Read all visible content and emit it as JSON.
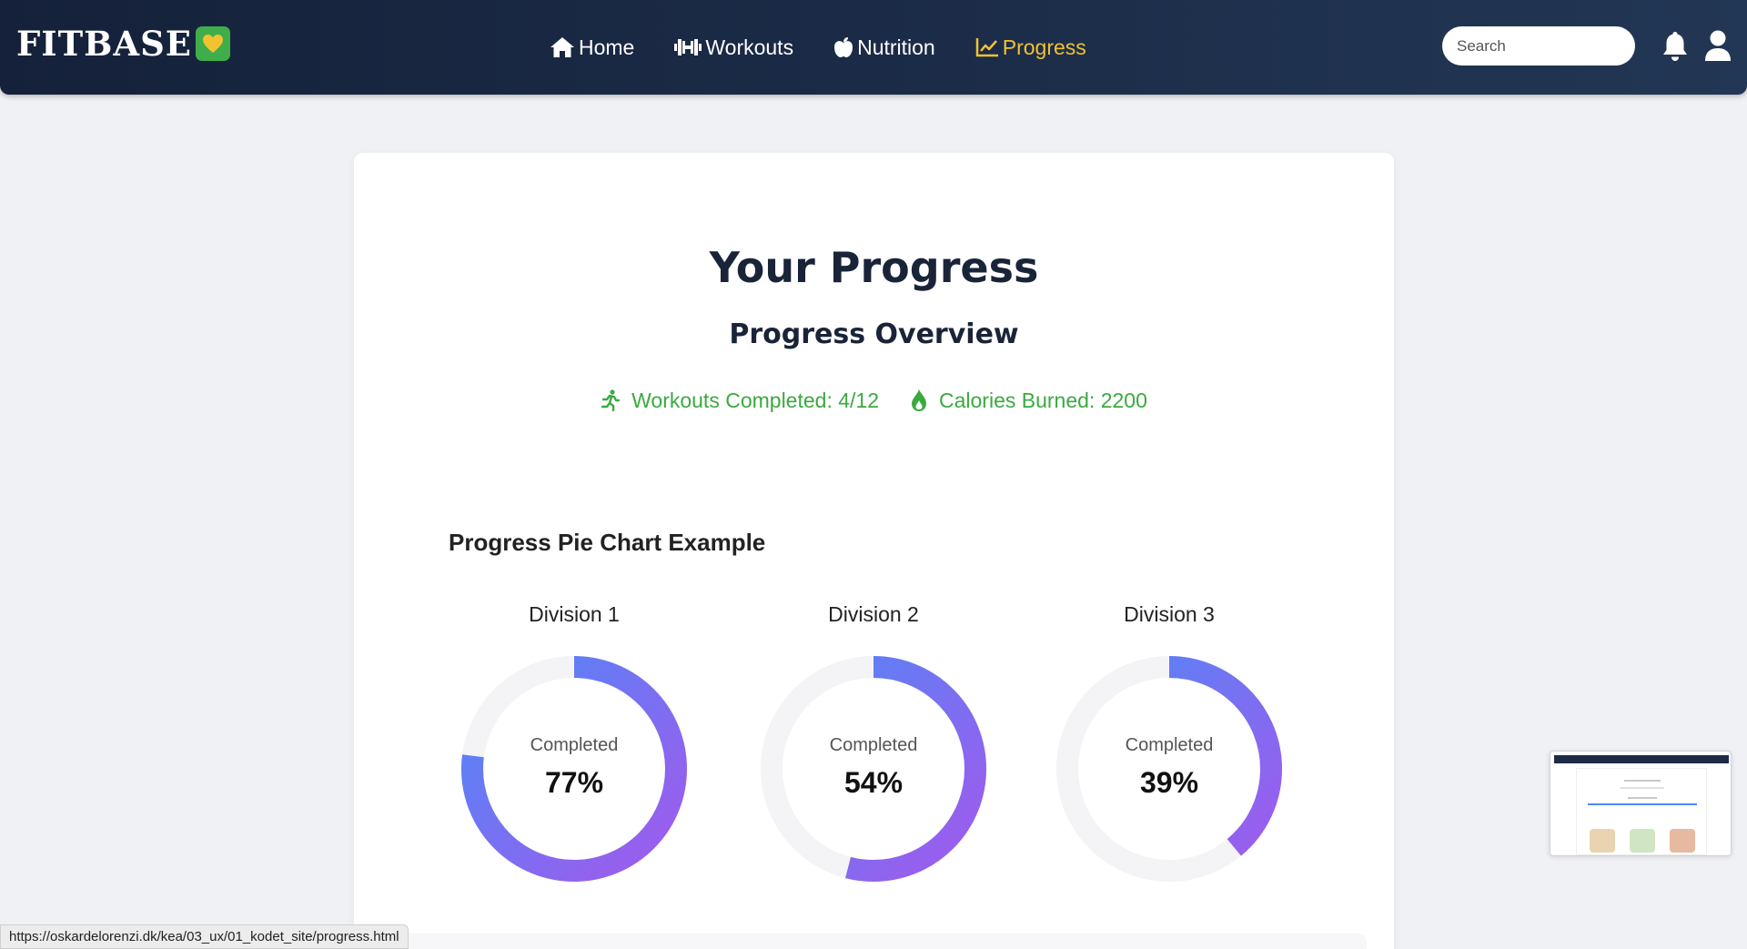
{
  "navbar": {
    "logo_text": "FITBASE",
    "links": [
      {
        "label": "Home",
        "icon": "home-icon"
      },
      {
        "label": "Workouts",
        "icon": "dumbbell-icon"
      },
      {
        "label": "Nutrition",
        "icon": "apple-icon"
      },
      {
        "label": "Progress",
        "icon": "chart-line-icon",
        "active": true
      }
    ],
    "search_placeholder": "Search"
  },
  "main": {
    "title": "Your Progress",
    "overview_title": "Progress Overview",
    "stats": {
      "workouts": "Workouts Completed: 4/12",
      "calories": "Calories Burned: 2200"
    },
    "chart_heading": "Progress Pie Chart Example"
  },
  "chart_data": [
    {
      "type": "pie",
      "title": "Division 1",
      "caption": "Completed",
      "value": 77,
      "label": "77%"
    },
    {
      "type": "pie",
      "title": "Division 2",
      "caption": "Completed",
      "value": 54,
      "label": "54%"
    },
    {
      "type": "pie",
      "title": "Division 3",
      "caption": "Completed",
      "value": 39,
      "label": "39%"
    }
  ],
  "colors": {
    "nav_bg": "#1b2b47",
    "accent_active": "#f2c230",
    "stat_green": "#3aaa3f",
    "ring_start": "#4f88f7",
    "ring_end": "#a259ec",
    "ring_track": "#f4f4f6"
  },
  "status_bar": {
    "url": "https://oskardelorenzi.dk/kea/03_ux/01_kodet_site/progress.html"
  }
}
